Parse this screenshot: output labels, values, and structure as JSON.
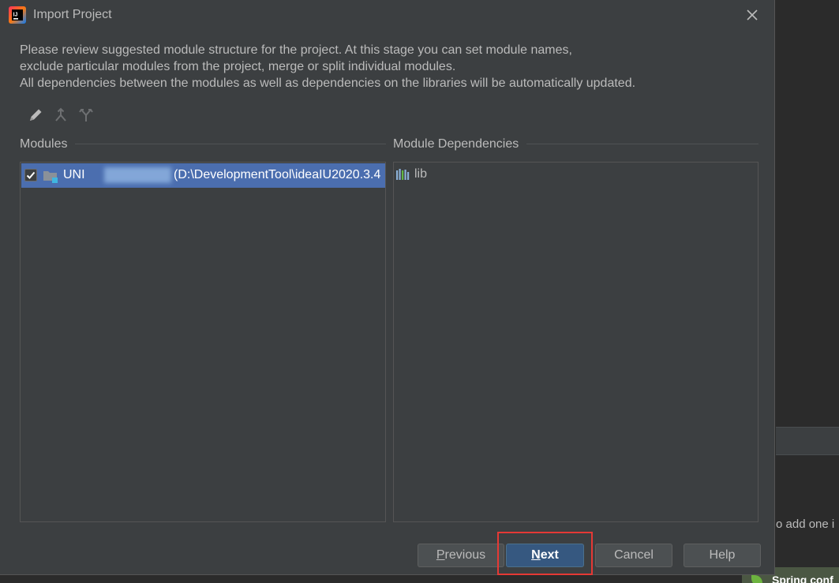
{
  "background": {
    "hint_text": "o add one i",
    "spring_label": "Spring conf"
  },
  "dialog": {
    "title": "Import Project",
    "app_icon": "intellij-idea-icon",
    "close_icon": "close-icon",
    "description": [
      "Please review suggested module structure for the project. At this stage you can set module names,",
      "exclude particular modules from the project, merge or split individual modules.",
      "All dependencies between the modules as well as dependencies on the libraries will be automatically updated."
    ],
    "toolbar": [
      {
        "name": "rename-icon",
        "enabled": true
      },
      {
        "name": "merge-icon",
        "enabled": false
      },
      {
        "name": "split-icon",
        "enabled": false
      }
    ],
    "modules": {
      "label": "Modules",
      "items": [
        {
          "checked": true,
          "name_visible": "UNI",
          "path": "(D:\\DevelopmentTool\\ideaIU2020.3.4",
          "selected": true
        }
      ]
    },
    "dependencies": {
      "label": "Module Dependencies",
      "items": [
        {
          "icon": "library-icon",
          "label": "lib"
        }
      ]
    },
    "buttons": {
      "previous": {
        "mnemonic": "P",
        "rest": "revious"
      },
      "next": {
        "mnemonic": "N",
        "rest": "ext"
      },
      "cancel": "Cancel",
      "help": "Help"
    },
    "highlight_color": "#e53935",
    "accent_color": "#4b6eaf"
  }
}
